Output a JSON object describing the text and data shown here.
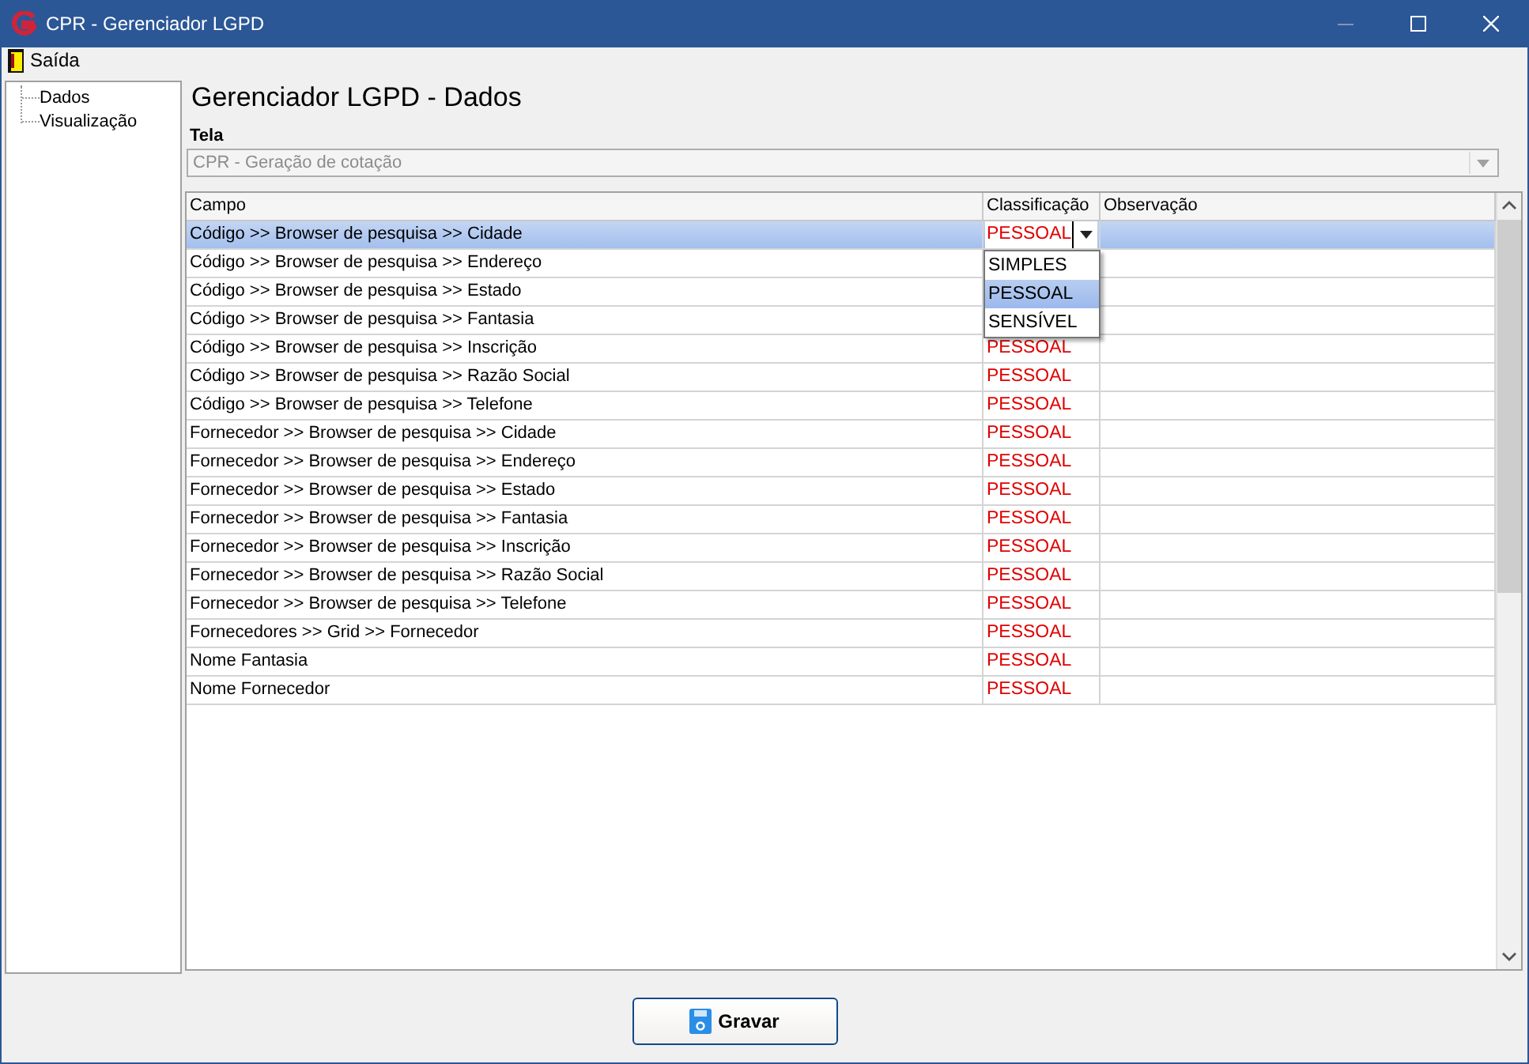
{
  "window": {
    "title": "CPR - Gerenciador LGPD"
  },
  "menu": [
    {
      "label": "Saída"
    }
  ],
  "tree": {
    "items": [
      {
        "label": "Dados"
      },
      {
        "label": "Visualização"
      }
    ]
  },
  "heading": "Gerenciador LGPD - Dados",
  "tela": {
    "label": "Tela",
    "value": "CPR - Geração de cotação",
    "disabled": true
  },
  "grid": {
    "columns": [
      "Campo",
      "Classificação",
      "Observação"
    ],
    "rows": [
      {
        "campo": "Código >> Browser de pesquisa >> Cidade",
        "classificacao": "PESSOAL",
        "selected": true
      },
      {
        "campo": "Código >> Browser de pesquisa >> Endereço",
        "selected": false
      },
      {
        "campo": "Código >> Browser de pesquisa >> Estado",
        "selected": false
      },
      {
        "campo": "Código >> Browser de pesquisa >> Fantasia",
        "selected": false
      },
      {
        "campo": "Código >> Browser de pesquisa >> Inscrição",
        "classificacao": "PESSOAL",
        "selected": false
      },
      {
        "campo": "Código >> Browser de pesquisa >> Razão Social",
        "classificacao": "PESSOAL",
        "selected": false
      },
      {
        "campo": "Código >> Browser de pesquisa >> Telefone",
        "classificacao": "PESSOAL",
        "selected": false
      },
      {
        "campo": "Fornecedor >> Browser de pesquisa >> Cidade",
        "classificacao": "PESSOAL",
        "selected": false
      },
      {
        "campo": "Fornecedor >> Browser de pesquisa >> Endereço",
        "classificacao": "PESSOAL",
        "selected": false
      },
      {
        "campo": "Fornecedor >> Browser de pesquisa >> Estado",
        "classificacao": "PESSOAL",
        "selected": false
      },
      {
        "campo": "Fornecedor >> Browser de pesquisa >> Fantasia",
        "classificacao": "PESSOAL",
        "selected": false
      },
      {
        "campo": "Fornecedor >> Browser de pesquisa >> Inscrição",
        "classificacao": "PESSOAL",
        "selected": false
      },
      {
        "campo": "Fornecedor >> Browser de pesquisa >> Razão Social",
        "classificacao": "PESSOAL",
        "selected": false
      },
      {
        "campo": "Fornecedor >> Browser de pesquisa >> Telefone",
        "classificacao": "PESSOAL",
        "selected": false
      },
      {
        "campo": "Fornecedores >> Grid >> Fornecedor",
        "classificacao": "PESSOAL",
        "selected": false
      },
      {
        "campo": "Nome Fantasia",
        "classificacao": "PESSOAL",
        "selected": false
      },
      {
        "campo": "Nome Fornecedor",
        "classificacao": "PESSOAL",
        "selected": false
      }
    ],
    "dropdown": {
      "options": [
        {
          "label": "SIMPLES",
          "selected": false
        },
        {
          "label": "PESSOAL",
          "selected": true
        },
        {
          "label": "SENSÍVEL",
          "selected": false
        }
      ]
    }
  },
  "buttons": [
    {
      "label": "Gravar"
    }
  ]
}
